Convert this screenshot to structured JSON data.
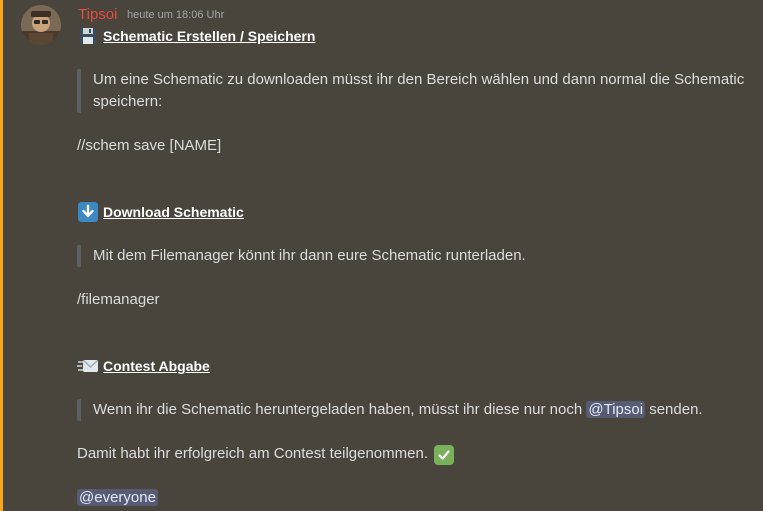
{
  "message": {
    "author": "Tipsoi",
    "timestamp": "heute um 18:06 Uhr",
    "author_color": "#e74c3c",
    "highlight_color": "#faa61a"
  },
  "sections": {
    "save": {
      "emoji": "floppy-disk-icon",
      "title": "Schematic Erstellen / Speichern",
      "quote": "Um eine Schematic zu downloaden müsst ihr den Bereich wählen und dann normal die Schematic speichern:",
      "command": "//schem save [NAME]"
    },
    "download": {
      "emoji": "arrow-down-icon",
      "title": "Download Schematic",
      "quote": "Mit dem Filemanager könnt ihr dann eure Schematic runterladen.",
      "command": "/filemanager"
    },
    "contest": {
      "emoji": "incoming-envelope-icon",
      "title": "Contest Abgabe",
      "quote_before": "Wenn ihr die Schematic heruntergeladen haben, müsst ihr diese nur noch",
      "quote_mention": "@Tipsoi",
      "quote_after": "senden.",
      "done_text": "Damit habt ihr erfolgreich am Contest teilgenommen.",
      "done_emoji": "check-mark-icon",
      "everyone": "@everyone"
    }
  }
}
